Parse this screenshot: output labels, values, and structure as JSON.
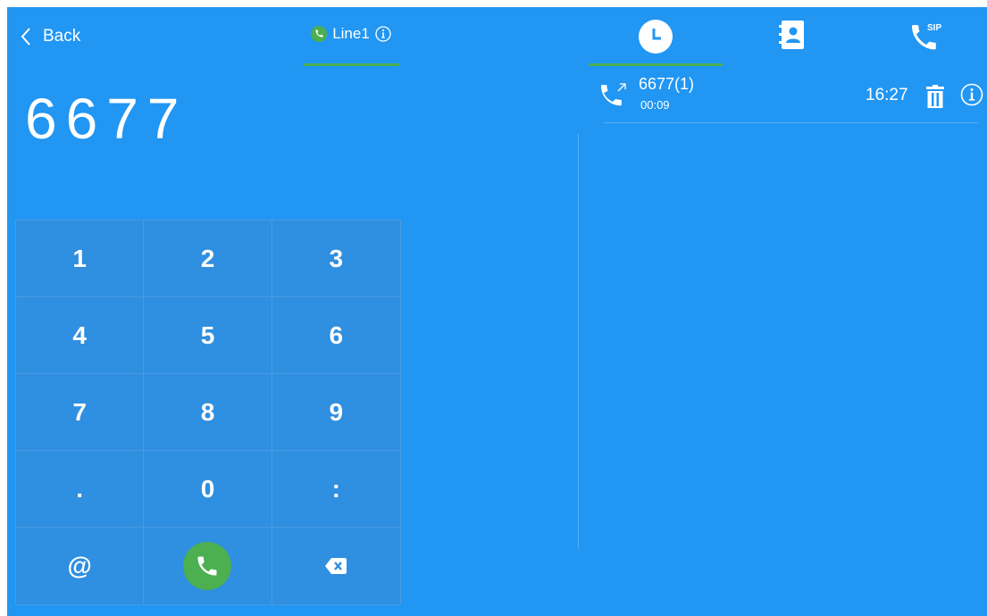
{
  "header": {
    "back_label": "Back",
    "line_label": "Line1"
  },
  "dialer": {
    "number": "6677",
    "keys": [
      "1",
      "2",
      "3",
      "4",
      "5",
      "6",
      "7",
      "8",
      "9",
      ".",
      "0",
      ":",
      "@"
    ]
  },
  "tabs": {
    "icons": [
      "clock-icon",
      "contacts-book-icon",
      "sip-phone-icon"
    ],
    "active": "history"
  },
  "history": {
    "entries": [
      {
        "name": "6677(1)",
        "duration": "00:09",
        "time": "16:27"
      }
    ]
  },
  "colors": {
    "background": "#2196f3",
    "keypad": "#2f8fe0",
    "accent_green": "#4caf50"
  }
}
